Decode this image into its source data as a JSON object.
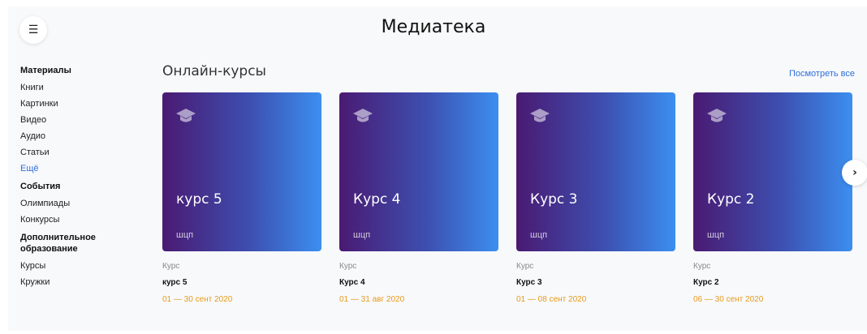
{
  "header": {
    "title": "Медиатека",
    "menu_icon": "☰"
  },
  "sidebar": {
    "materials": {
      "heading": "Материалы",
      "items": [
        "Книги",
        "Картинки",
        "Видео",
        "Аудио",
        "Статьи"
      ],
      "more": "Ещё"
    },
    "events": {
      "heading": "События",
      "items": [
        "Олимпиады",
        "Конкурсы"
      ]
    },
    "education": {
      "heading_line1": "Дополнительное",
      "heading_line2": "образование",
      "items": [
        "Курсы",
        "Кружки"
      ]
    }
  },
  "section": {
    "title": "Онлайн-курсы",
    "see_all": "Посмотреть все"
  },
  "cards": [
    {
      "cover_name": "курс 5",
      "cover_org": "шцп",
      "type": "Курс",
      "title": "курс 5",
      "date": "01 — 30 сент 2020",
      "icon": "graduation-cap-icon"
    },
    {
      "cover_name": "Курс 4",
      "cover_org": "шцп",
      "type": "Курс",
      "title": "Курс 4",
      "date": "01 — 31 авг 2020",
      "icon": "graduation-cap-icon"
    },
    {
      "cover_name": "Курс 3",
      "cover_org": "шцп",
      "type": "Курс",
      "title": "Курс 3",
      "date": "01 — 08 сент 2020",
      "icon": "graduation-cap-icon"
    },
    {
      "cover_name": "Курс 2",
      "cover_org": "шцп",
      "type": "Курс",
      "title": "Курс 2",
      "date": "06 — 30 сент 2020",
      "icon": "graduation-cap-icon"
    }
  ],
  "carousel": {
    "next_icon": "›"
  },
  "colors": {
    "accent_link": "#2f6fdc",
    "date": "#e89a1a",
    "gradient_start": "#4a1a72",
    "gradient_end": "#3b8ff0"
  }
}
